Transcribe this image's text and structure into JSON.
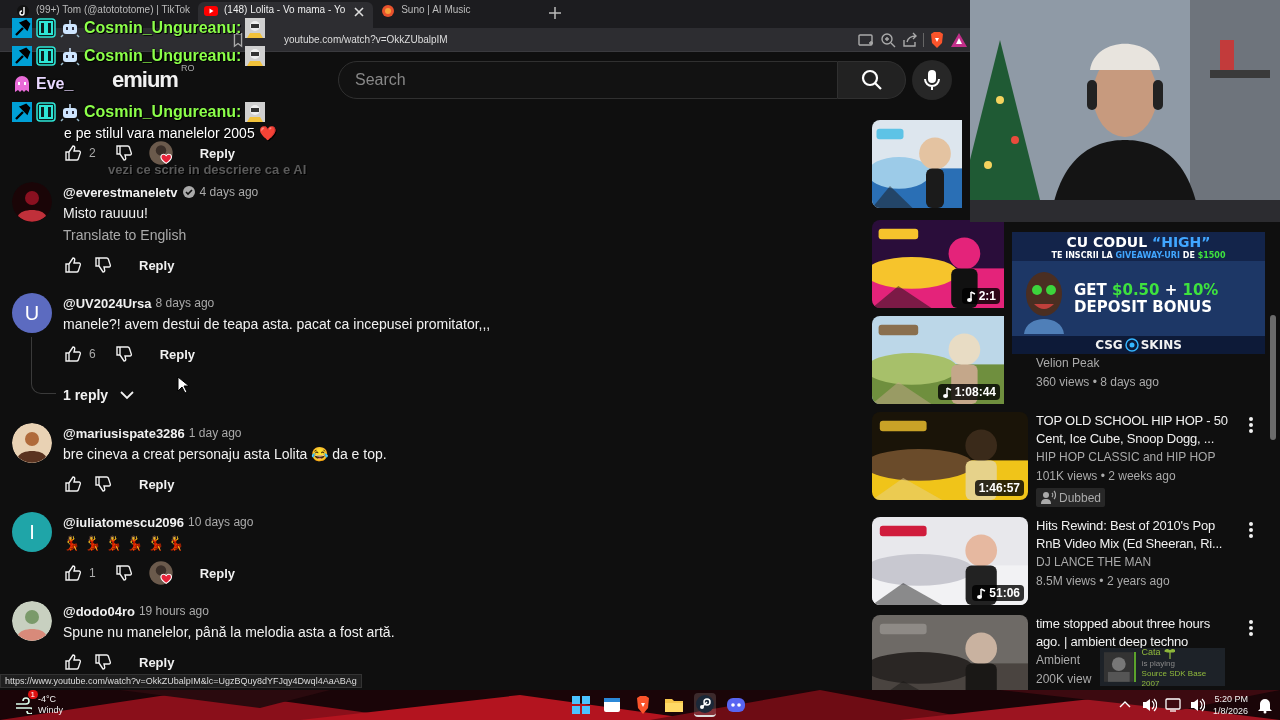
{
  "browser": {
    "tabs": [
      {
        "title": "(99+) Tom (@atotototome) | TikTok",
        "selected": false
      },
      {
        "title": "(148) Lolita - Vo   mama - Yo",
        "selected": true
      },
      {
        "title": "Suno | AI Music",
        "selected": false
      }
    ],
    "url": "youtube.com/watch?v=OkkZUbalpIM"
  },
  "youtube": {
    "logo": "emium",
    "country": "RO",
    "search": {
      "placeholder": "Search"
    }
  },
  "comments": [
    {
      "kind": "actions",
      "likes": "2",
      "creator_heart": true,
      "reply": "Reply"
    },
    {
      "kind": "comment",
      "author": "@everestmaneletv",
      "verified": true,
      "time": "4 days ago",
      "text": "Misto rauuuu!",
      "translate": "Translate to English",
      "reply": "Reply"
    },
    {
      "kind": "comment",
      "avatar": {
        "kind": "letter",
        "letter": "U",
        "color": "#5c6bc0"
      },
      "author": "@UV2024Ursa",
      "time": "8 days ago",
      "text": "manele?! avem destui de teapa asta. pacat ca incepusei promitator,,,",
      "likes": "6",
      "reply": "Reply",
      "replies": "1 reply"
    },
    {
      "kind": "comment",
      "author": "@mariusispate3286",
      "time": "1 day ago",
      "text": "bre cineva a creat personaju asta Lolita 😂 da e top.",
      "reply": "Reply"
    },
    {
      "kind": "comment",
      "avatar": {
        "kind": "letter",
        "letter": "I",
        "color": "#1fa5a8"
      },
      "author": "@iuliatomescu2096",
      "time": "10 days ago",
      "text": "💃 💃 💃 💃 💃 💃",
      "likes": "1",
      "creator_heart": true,
      "reply": "Reply"
    },
    {
      "kind": "comment",
      "author": "@dodo04ro",
      "time": "19 hours ago",
      "text": "Spune nu manelelor, până la melodia asta a fost artă.",
      "reply": "Reply"
    }
  ],
  "sidebar": [
    {
      "kind": "thumb_only"
    },
    {
      "kind": "partial",
      "duration": "2:1",
      "music": true
    },
    {
      "kind": "partial",
      "channel": "Velion Peak",
      "meta": "360 views • 8 days ago",
      "duration": "1:08:44",
      "music": true
    },
    {
      "kind": "video",
      "title": "TOP OLD SCHOOL HIP HOP - 50 Cent, Ice Cube, Snoop Dogg, ...",
      "channel": "HIP HOP CLASSIC and HIP HOP",
      "meta": "101K views • 2 weeks ago",
      "badge": "Dubbed",
      "duration": "1:46:57"
    },
    {
      "kind": "video",
      "title": "Hits Rewind: Best of 2010's Pop RnB Video Mix (Ed Sheeran, Ri...",
      "channel": "DJ LANCE THE MAN",
      "meta": "8.5M views • 2 years ago",
      "duration": "51:06",
      "music": true
    },
    {
      "kind": "video",
      "title": "time stopped about three hours ago. | ambient deep techno",
      "channel": "Ambient",
      "meta": "200K view"
    }
  ],
  "status_url": "https://www.youtube.com/watch?v=OkkZUbalpIM&lc=UgzBQuy8dYFJqy4Dwql4AaABAg",
  "chat": [
    {
      "kind": "badged",
      "author": "Cosmin_Ungureanu:"
    },
    {
      "kind": "badged",
      "author": "Cosmin_Ungureanu:"
    },
    {
      "kind": "ghost",
      "author": "Eve_"
    },
    {
      "kind": "badged",
      "author": "Cosmin_Ungureanu:",
      "text": "e pe stilul vara manelelor 2005 ❤️"
    },
    {
      "kind": "faded",
      "text": "vezi ce scrie in descriere ca e AI"
    }
  ],
  "ad": {
    "lines": [
      [
        {
          "text": "CU CODUL ",
          "color": "#ffffff"
        },
        {
          "text": "“HIGH”",
          "color": "#41a6ff"
        }
      ],
      [
        {
          "text": "TE INSCRII LA ",
          "color": "#ffffff"
        },
        {
          "text": "GIVEAWAY-URI",
          "color": "#41a6ff"
        },
        {
          "text": " DE ",
          "color": "#ffffff"
        },
        {
          "text": "$1500",
          "color": "#3ee23e"
        }
      ],
      [
        {
          "text": "GET ",
          "color": "#ffffff"
        },
        {
          "text": "$0.50",
          "color": "#3ee23e"
        },
        {
          "text": " + ",
          "color": "#ffffff"
        },
        {
          "text": "10%",
          "color": "#3ee23e"
        }
      ],
      [
        {
          "text": "DEPOSIT BONUS",
          "color": "#ffffff"
        }
      ]
    ],
    "brand_left": "CSG",
    "brand_right": "SKINS"
  },
  "toast": {
    "name": "Cata",
    "status": "is playing",
    "game": "Source SDK Base 2007"
  },
  "taskbar": {
    "weather": {
      "temp": "-4°C",
      "condition": "Windy",
      "alerts": "1"
    },
    "apps": [
      {
        "kind": "windows"
      },
      {
        "kind": "window"
      },
      {
        "kind": "brave"
      },
      {
        "kind": "folder"
      },
      {
        "kind": "steam",
        "running": true
      },
      {
        "kind": "discord"
      }
    ],
    "time": "5:20 PM",
    "date": "1/8/2026"
  }
}
